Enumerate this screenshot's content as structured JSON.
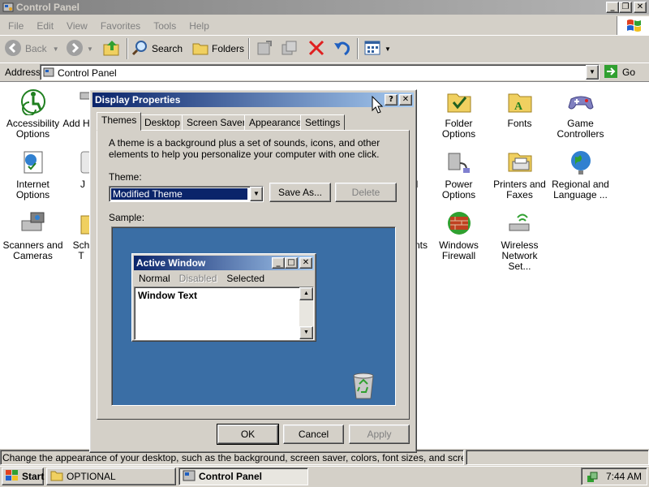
{
  "window": {
    "title": "Control Panel"
  },
  "menu": [
    "File",
    "Edit",
    "View",
    "Favorites",
    "Tools",
    "Help"
  ],
  "toolbar": {
    "back": "Back",
    "search": "Search",
    "folders": "Folders"
  },
  "address": {
    "label": "Address",
    "value": "Control Panel",
    "go": "Go"
  },
  "icons": [
    {
      "label": "Accessibility Options",
      "name": "accessibility-options"
    },
    {
      "label": "Add H",
      "name": "add-hardware"
    },
    {
      "label": "Folder Options",
      "name": "folder-options"
    },
    {
      "label": "Fonts",
      "name": "fonts"
    },
    {
      "label": "Game Controllers",
      "name": "game-controllers"
    },
    {
      "label": "Internet Options",
      "name": "internet-options"
    },
    {
      "label": "J",
      "name": "java"
    },
    {
      "label": "d",
      "name": "partial-d"
    },
    {
      "label": "Power Options",
      "name": "power-options"
    },
    {
      "label": "Printers and Faxes",
      "name": "printers-and-faxes"
    },
    {
      "label": "Regional and Language ...",
      "name": "regional-and-language"
    },
    {
      "label": "Scanners and Cameras",
      "name": "scanners-and-cameras"
    },
    {
      "label": "Sch T",
      "name": "scheduled-tasks"
    },
    {
      "label": "nts",
      "name": "partial-nts"
    },
    {
      "label": "Windows Firewall",
      "name": "windows-firewall"
    },
    {
      "label": "Wireless Network Set...",
      "name": "wireless-network-setup"
    }
  ],
  "dialog": {
    "title": "Display Properties",
    "tabs": [
      "Themes",
      "Desktop",
      "Screen Saver",
      "Appearance",
      "Settings"
    ],
    "description": "A theme is a background plus a set of sounds, icons, and other elements to help you personalize your computer with one click.",
    "theme_label": "Theme:",
    "theme_value": "Modified Theme",
    "save_as": "Save As...",
    "delete": "Delete",
    "sample_label": "Sample:",
    "preview": {
      "title": "Active Window",
      "menu": [
        "Normal",
        "Disabled",
        "Selected"
      ],
      "text": "Window Text"
    },
    "ok": "OK",
    "cancel": "Cancel",
    "apply": "Apply"
  },
  "status": {
    "text": "Change the appearance of your desktop, such as the background, screen saver, colors, font sizes, and screen resolutio"
  },
  "taskbar": {
    "start": "Start",
    "tasks": [
      "OPTIONAL",
      "Control Panel"
    ],
    "clock": "7:44 AM"
  },
  "colors": {
    "active_title": "#0a246a",
    "desktop_sample": "#3a6ea5",
    "selection": "#0a246a"
  }
}
